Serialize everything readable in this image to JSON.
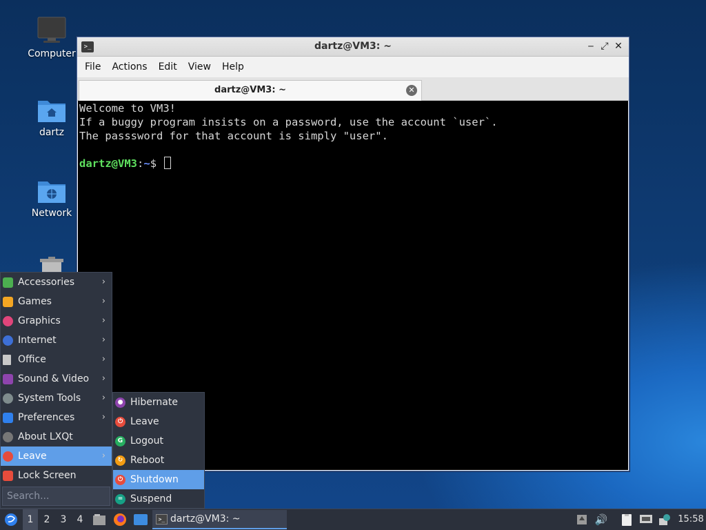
{
  "desktop": {
    "icons": [
      {
        "label": "Computer",
        "icon": "monitor-icon"
      },
      {
        "label": "dartz",
        "icon": "home-folder-icon"
      },
      {
        "label": "Network",
        "icon": "network-folder-icon"
      },
      {
        "label": "",
        "icon": "trash-icon"
      }
    ]
  },
  "window": {
    "title": "dartz@VM3: ~",
    "controls": {
      "minimize": "‒",
      "maximize": "⤢",
      "close": "✕"
    },
    "menu": [
      "File",
      "Actions",
      "Edit",
      "View",
      "Help"
    ],
    "tab": {
      "label": "dartz@VM3: ~",
      "close": "✕"
    }
  },
  "terminal": {
    "lines": [
      "Welcome to VM3!",
      "If a buggy program insists on a password, use the account `user`.",
      "The passsword for that account is simply \"user\"."
    ],
    "prompt_user": "dartz@VM3",
    "prompt_sep": ":",
    "prompt_path": "~",
    "prompt_symbol": "$ "
  },
  "start_menu": {
    "items": [
      {
        "label": "Accessories",
        "icon": "accessories-icon",
        "has_submenu": true,
        "color": "#4caf50"
      },
      {
        "label": "Games",
        "icon": "games-icon",
        "has_submenu": true,
        "color": "#f4a623"
      },
      {
        "label": "Graphics",
        "icon": "graphics-icon",
        "has_submenu": true,
        "color": "#e0457b"
      },
      {
        "label": "Internet",
        "icon": "internet-icon",
        "has_submenu": true,
        "color": "#3d6fd6"
      },
      {
        "label": "Office",
        "icon": "office-icon",
        "has_submenu": true,
        "color": "#c8c8c8"
      },
      {
        "label": "Sound & Video",
        "icon": "sound-video-icon",
        "has_submenu": true,
        "color": "#8e44ad"
      },
      {
        "label": "System Tools",
        "icon": "system-tools-icon",
        "has_submenu": true,
        "color": "#7f8c8d"
      },
      {
        "label": "Preferences",
        "icon": "preferences-icon",
        "has_submenu": true,
        "color": "#2f80ed"
      },
      {
        "label": "About LXQt",
        "icon": "info-icon",
        "has_submenu": false,
        "color": "#777777"
      },
      {
        "label": "Leave",
        "icon": "power-icon",
        "has_submenu": true,
        "color": "#e74c3c"
      },
      {
        "label": "Lock Screen",
        "icon": "lock-icon",
        "has_submenu": false,
        "color": "#e74c3c"
      }
    ],
    "active_item": "Leave",
    "search_placeholder": "Search..."
  },
  "leave_submenu": {
    "items": [
      {
        "label": "Hibernate",
        "icon": "hibernate-icon",
        "color": "#8e44ad"
      },
      {
        "label": "Leave",
        "icon": "power-icon",
        "color": "#e74c3c"
      },
      {
        "label": "Logout",
        "icon": "logout-icon",
        "color": "#27ae60"
      },
      {
        "label": "Reboot",
        "icon": "reboot-icon",
        "color": "#f39c12"
      },
      {
        "label": "Shutdown",
        "icon": "shutdown-icon",
        "color": "#e74c3c"
      },
      {
        "label": "Suspend",
        "icon": "suspend-icon",
        "color": "#16a085"
      }
    ],
    "active_item": "Shutdown"
  },
  "taskbar": {
    "desktops": [
      "1",
      "2",
      "3",
      "4"
    ],
    "active_desktop": "1",
    "task_label": "dartz@VM3: ~",
    "clock": "15:58"
  },
  "colors": {
    "accent": "#5f9ee8",
    "prompt_green": "#5fe05f",
    "prompt_blue": "#6a8fff"
  }
}
